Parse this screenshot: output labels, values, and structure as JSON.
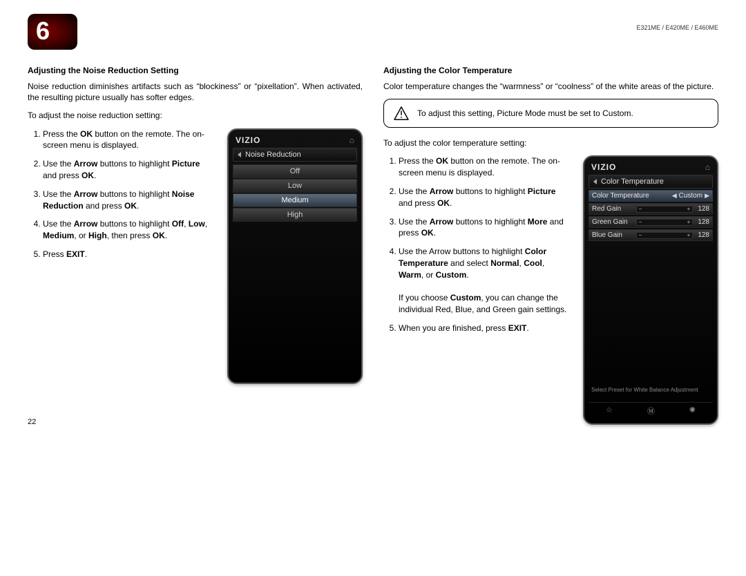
{
  "chapter": "6",
  "model_line": "E321ME / E420ME / E460ME",
  "page_number": "22",
  "left": {
    "heading": "Adjusting the Noise Reduction Setting",
    "intro": "Noise reduction diminishes artifacts such as “blockiness” or “pixellation”. When activated, the resulting picture usually has softer edges.",
    "lead": "To adjust the noise reduction setting:",
    "steps": [
      "Press the <b>OK</b> button on the remote. The on-screen menu is displayed.",
      "Use the <b>Arrow</b> buttons to highlight <b>Picture</b> and press <b>OK</b>.",
      "Use the <b>Arrow</b> buttons to highlight <b>Noise Reduction</b> and press <b>OK</b>.",
      "Use the <b>Arrow</b> buttons to highlight <b>Off</b>, <b>Low</b>, <b>Medium</b>, or <b>High</b>, then press <b>OK</b>.",
      "Press <b>EXIT</b>."
    ],
    "menu_title": "Noise Reduction",
    "options": [
      "Off",
      "Low",
      "Medium",
      "High"
    ],
    "selected": "Medium",
    "brand": "VIZIO"
  },
  "right": {
    "heading": "Adjusting the Color Temperature",
    "intro": "Color temperature changes the “warmness” or “coolness” of the white areas of the picture.",
    "note": "To adjust this setting, Picture Mode must be set to Custom.",
    "lead": "To adjust the color temperature setting:",
    "steps": [
      "Press the <b>OK</b> button on the remote. The on-screen menu is displayed.",
      "Use the <b>Arrow</b> buttons to highlight <b>Picture</b> and press <b>OK</b>.",
      "Use the <b>Arrow</b> buttons to highlight <b>More</b> and press <b>OK</b>.",
      "Use the Arrow buttons to highlight <b>Color Temperature</b> and select <b>Normal</b>, <b>Cool</b>, <b>Warm</b>, or <b>Custom</b>.<br><br>If you choose <b>Custom</b>, you can change the individual Red, Blue, and Green gain settings.",
      "When you are finished, press <b>EXIT</b>."
    ],
    "menu_title": "Color Temperature",
    "selector_label": "Color Temperature",
    "selector_value": "Custom",
    "gains": [
      {
        "label": "Red Gain",
        "value": "128"
      },
      {
        "label": "Green Gain",
        "value": "128"
      },
      {
        "label": "Blue Gain",
        "value": "128"
      }
    ],
    "hint": "Select Preset for White Balance Adjustment",
    "brand": "VIZIO"
  }
}
